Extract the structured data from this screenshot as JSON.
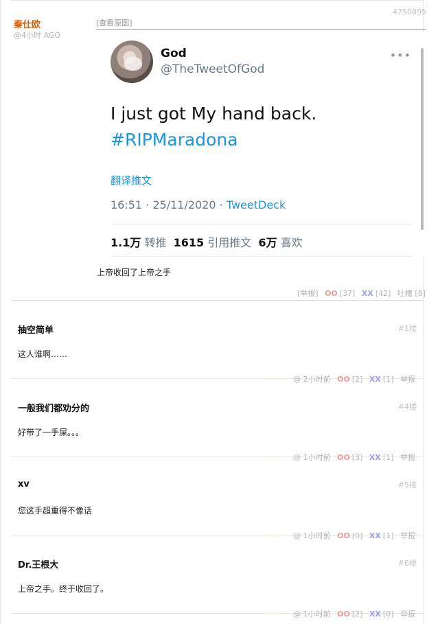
{
  "post": {
    "author": "秦仕欧",
    "time": "@4小时 AGO",
    "id": "4750895",
    "view_original": "[查看原图]",
    "caption": "上帝收回了上帝之手",
    "report": "[举报]",
    "oo_label": "OO",
    "oo_count": "[37]",
    "xx_label": "XX",
    "xx_count": "[42]",
    "tucao": "吐槽 [8]"
  },
  "tweet": {
    "name": "God",
    "handle": "@TheTweetOfGod",
    "more": "•••",
    "text": "I just got My hand back.",
    "hashtag": "#RIPMaradona",
    "translate": "翻译推文",
    "datetime": "16:51 · 25/11/2020 · ",
    "source": "TweetDeck",
    "retweets_num": "1.1万",
    "retweets_label": "转推",
    "quotes_num": "1615",
    "quotes_label": "引用推文",
    "likes_num": "6万",
    "likes_label": "喜欢"
  },
  "comments": [
    {
      "author": "抽空简单",
      "floor": "#1楼",
      "text": "这人谁啊……",
      "time": "@ 2小时前",
      "oo": "[2]",
      "xx": "[1]"
    },
    {
      "author": "一般我们都劝分的",
      "floor": "#4楼",
      "text": "好带了一手屎。。。",
      "time": "@ 1小时前",
      "oo": "[3]",
      "xx": "[1]"
    },
    {
      "author": "xv",
      "floor": "#5楼",
      "text": "您这手超重得不像话",
      "time": "@ 1小时前",
      "oo": "[0]",
      "xx": "[1]"
    },
    {
      "author": "Dr.王根大",
      "floor": "#6楼",
      "text": "上帝之手。终于收回了。",
      "time": "@ 1小时前",
      "oo": "[2]",
      "xx": "[0]"
    }
  ],
  "labels": {
    "oo": "OO",
    "xx": "XX",
    "report": "举报"
  },
  "colors": {
    "author": "#e05a00",
    "oo": "#f39999",
    "xx": "#9e9eef",
    "link": "#1b95e0"
  }
}
